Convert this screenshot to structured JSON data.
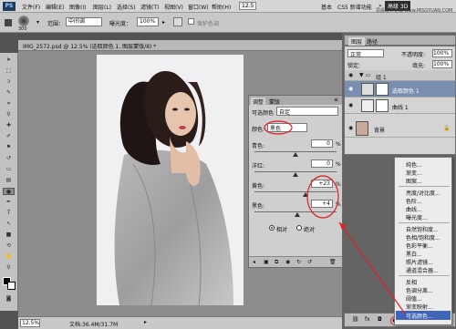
{
  "menubar": {
    "logo": "PS",
    "items": [
      "文件(F)",
      "编辑(E)",
      "图像(I)",
      "图层(L)",
      "选择(S)",
      "滤镜(T)",
      "视图(V)",
      "窗口(W)",
      "帮助(H)"
    ],
    "zoom_combo": "12.5",
    "right_labels": [
      "基本",
      "CS5 新增功能",
      "»"
    ],
    "highlight": "高级 3D",
    "watermark": "思缘设计论坛 www.MISSYUAN.COM"
  },
  "optbar": {
    "brush_size": "300",
    "mode_label": "模式：",
    "mode_value": "正常",
    "opacity_label": "不透明度：",
    "opacity_value": "100%",
    "flow_label": "流量：",
    "flow_value": "100%",
    "range_label": "范围：",
    "range_value": "中间调",
    "exposure_label": "曝光度：",
    "exposure_value": "100%",
    "protect_label": "保护色调"
  },
  "document": {
    "tab_title": "IMG_2572.psd @ 12.5% (选取颜色 1, 图层蒙版/8) *",
    "zoom_status": "12.5%",
    "doc_status": "文档:36.4M/31.7M"
  },
  "adjust_panel": {
    "tabs": [
      "调整",
      "蒙版"
    ],
    "title": "可选颜色",
    "preset_value": "自定",
    "colors_label": "颜色:",
    "colors_value": "黑色",
    "sliders": [
      {
        "label": "青色:",
        "value": "0",
        "unit": "%",
        "fraction": 0.5
      },
      {
        "label": "洋红:",
        "value": "0",
        "unit": "%",
        "fraction": 0.5
      },
      {
        "label": "黄色:",
        "value": "+23",
        "unit": "%",
        "fraction": 0.62
      },
      {
        "label": "黑色:",
        "value": "+4",
        "unit": "%",
        "fraction": 0.52
      }
    ],
    "method_relative": "相对",
    "method_absolute": "绝对"
  },
  "layers_panel": {
    "tabs": [
      "图层",
      "路径"
    ],
    "blend_mode": "正常",
    "opacity_label": "不透明度:",
    "opacity_value": "100%",
    "lock_label": "锁定:",
    "fill_label": "填充:",
    "fill_value": "100%",
    "group": "组 1",
    "layers": [
      {
        "name": "选取颜色 1"
      },
      {
        "name": "曲线 1"
      },
      {
        "name": "背景"
      }
    ]
  },
  "context_menu": {
    "items": [
      "纯色...",
      "渐变...",
      "图案...",
      "亮度/对比度...",
      "色阶...",
      "曲线...",
      "曝光度...",
      "自然饱和度...",
      "色相/饱和度...",
      "色彩平衡...",
      "黑白...",
      "照片滤镜...",
      "通道混合器...",
      "反相",
      "色调分离...",
      "阈值...",
      "渐变映射...",
      "可选颜色..."
    ],
    "highlighted": "可选颜色..."
  },
  "colors": {
    "annotation_red": "#e02020",
    "menu_highlight": "#3f64b8"
  }
}
